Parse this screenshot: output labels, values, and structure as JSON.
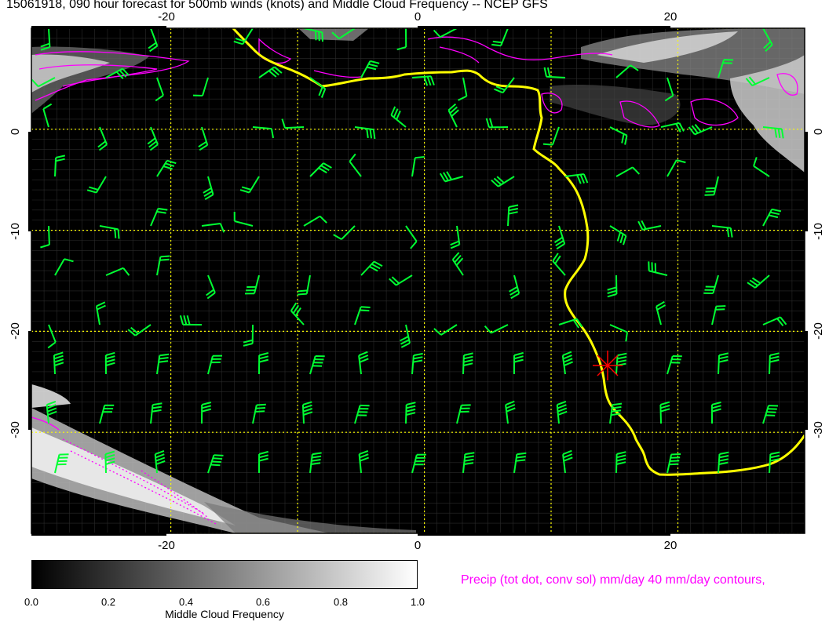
{
  "title": "15061918, 090 hour forecast for 500mb winds (knots) and Middle Cloud Frequency -- NCEP GFS",
  "map": {
    "lon_range": [
      -31,
      30
    ],
    "lat_range": [
      -40,
      10
    ],
    "lon_ticks": [
      "-20",
      "0",
      "20"
    ],
    "lat_ticks": [
      "0",
      "-10",
      "-20",
      "-30"
    ],
    "gridline_lons": [
      -20,
      -10,
      0,
      10,
      20
    ],
    "gridline_lats": [
      10,
      0,
      -10,
      -20,
      -30,
      -40
    ],
    "colors": {
      "background": "#000000",
      "coastline": "#ffff00",
      "wind_barbs": "#00ff33",
      "precip": "#ff00ff",
      "grid": "#ffff00",
      "marker": "#ff0000"
    },
    "marker": {
      "label": "star",
      "lon": 15,
      "lat": -23.5
    }
  },
  "colorbar": {
    "ticks": [
      "0.0",
      "0.2",
      "0.4",
      "0.6",
      "0.8",
      "1.0"
    ],
    "label": "Middle Cloud Frequency"
  },
  "precip_note": "Precip (tot dot, conv sol) mm/day 40 mm/day contours,"
}
